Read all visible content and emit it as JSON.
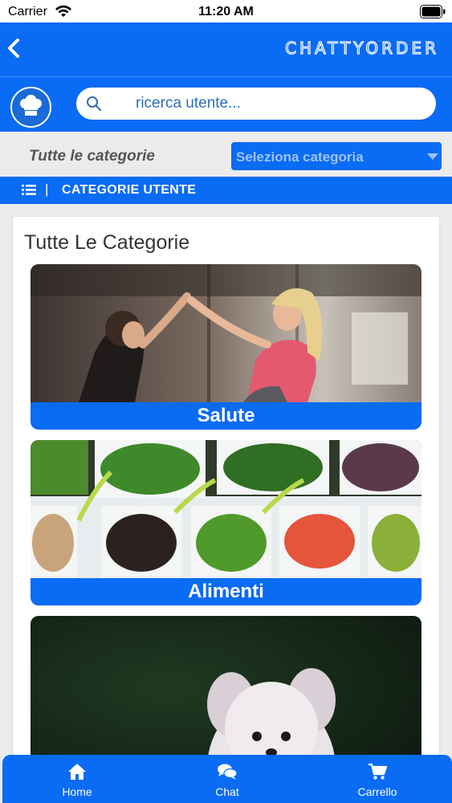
{
  "status_bar": {
    "carrier": "Carrier",
    "time": "11:20 AM"
  },
  "header": {
    "brand": "CHATTYORDER"
  },
  "search": {
    "placeholder": "ricerca utente..."
  },
  "filter": {
    "label": "Tutte le categorie",
    "select_value": "Seleziona categoria"
  },
  "section": {
    "title": "CATEGORIE UTENTE",
    "separator": "|"
  },
  "card": {
    "title": "Tutte Le Categorie",
    "categories": [
      {
        "label": "Salute",
        "image": "fitness-photo"
      },
      {
        "label": "Alimenti",
        "image": "vegetables-photo"
      },
      {
        "label": "",
        "image": "dog-photo"
      }
    ]
  },
  "tabs": [
    {
      "label": "Home",
      "icon": "home-icon"
    },
    {
      "label": "Chat",
      "icon": "chat-icon"
    },
    {
      "label": "Carrello",
      "icon": "cart-icon"
    }
  ],
  "colors": {
    "primary": "#0a6bf4",
    "background": "#ebebeb"
  }
}
